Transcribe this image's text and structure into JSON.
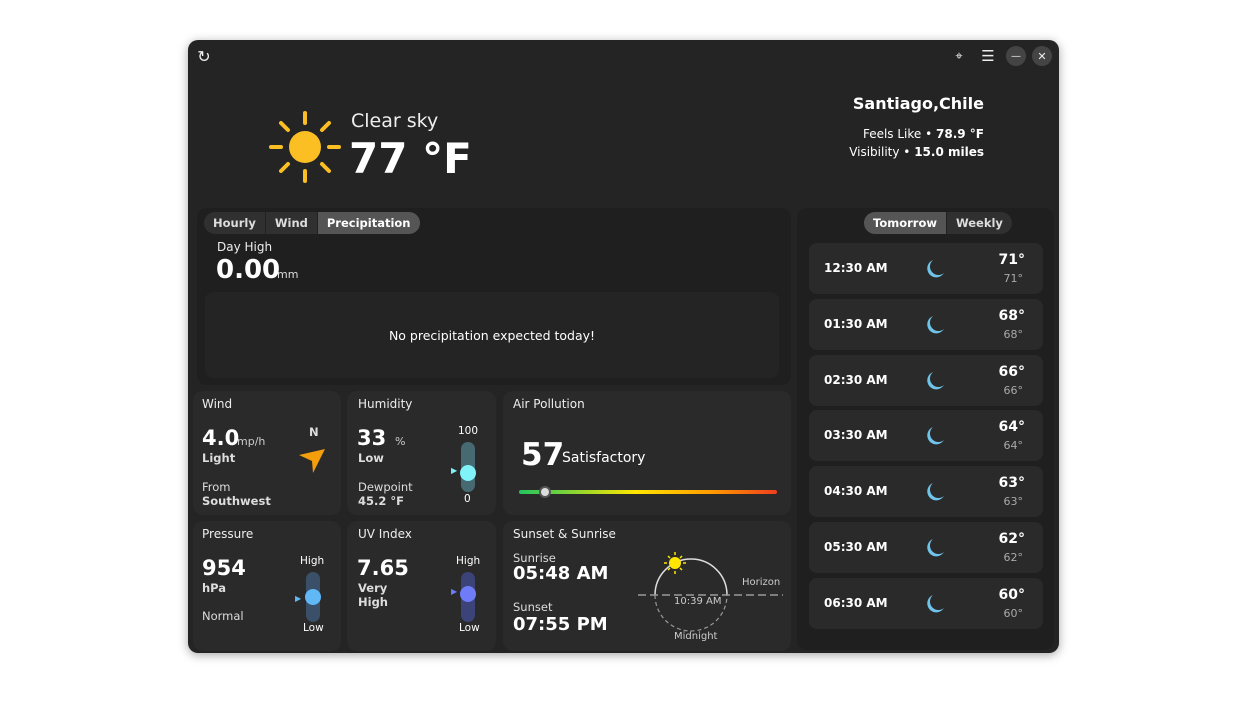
{
  "header": {
    "condition": "Clear sky",
    "temperature": "77 °F",
    "location": "Santiago,Chile",
    "feels_like_label": "Feels Like •",
    "feels_like": "78.9 °F",
    "visibility_label": "Visibility •",
    "visibility": "15.0 miles"
  },
  "toolbar": {
    "refresh": "refresh-icon",
    "locate": "locate-icon",
    "menu": "menu-icon",
    "minimize": "minimize-icon",
    "close": "close-icon"
  },
  "forecast": {
    "tabs": [
      "Hourly",
      "Wind",
      "Precipitation"
    ],
    "active_tab": "Precipitation",
    "label": "Day High",
    "value": "0.00",
    "unit": "mm",
    "message": "No precipitation expected today!"
  },
  "wind": {
    "title": "Wind",
    "value": "4.0",
    "unit": "mp/h",
    "desc": "Light",
    "from_label": "From",
    "from": "Southwest",
    "compass": "N"
  },
  "humidity": {
    "title": "Humidity",
    "value": "33",
    "unit": "%",
    "desc": "Low",
    "dew_label": "Dewpoint",
    "dew": "45.2 °F",
    "max": "100",
    "min": "0",
    "level": 0.33
  },
  "air": {
    "title": "Air Pollution",
    "value": "57",
    "desc": "Satisfactory",
    "level": 0.1
  },
  "pressure": {
    "title": "Pressure",
    "value": "954",
    "unit": "hPa",
    "desc": "Normal",
    "high": "High",
    "low": "Low",
    "level": 0.5
  },
  "uv": {
    "title": "UV Index",
    "value": "7.65",
    "desc1": "Very",
    "desc2": "High",
    "high": "High",
    "low": "Low",
    "level": 0.6
  },
  "sun": {
    "title": "Sunset & Sunrise",
    "sunrise_label": "Sunrise",
    "sunrise": "05:48 AM",
    "sunset_label": "Sunset",
    "sunset": "07:55 PM",
    "now": "10:39 AM",
    "horizon": "Horizon",
    "midnight": "Midnight"
  },
  "side": {
    "tabs": [
      "Tomorrow",
      "Weekly"
    ],
    "active_tab": "Tomorrow",
    "hours": [
      {
        "time": "12:30 AM",
        "hi": "71°",
        "lo": "71°"
      },
      {
        "time": "01:30 AM",
        "hi": "68°",
        "lo": "68°"
      },
      {
        "time": "02:30 AM",
        "hi": "66°",
        "lo": "66°"
      },
      {
        "time": "03:30 AM",
        "hi": "64°",
        "lo": "64°"
      },
      {
        "time": "04:30 AM",
        "hi": "63°",
        "lo": "63°"
      },
      {
        "time": "05:30 AM",
        "hi": "62°",
        "lo": "62°"
      },
      {
        "time": "06:30 AM",
        "hi": "60°",
        "lo": "60°"
      }
    ]
  }
}
